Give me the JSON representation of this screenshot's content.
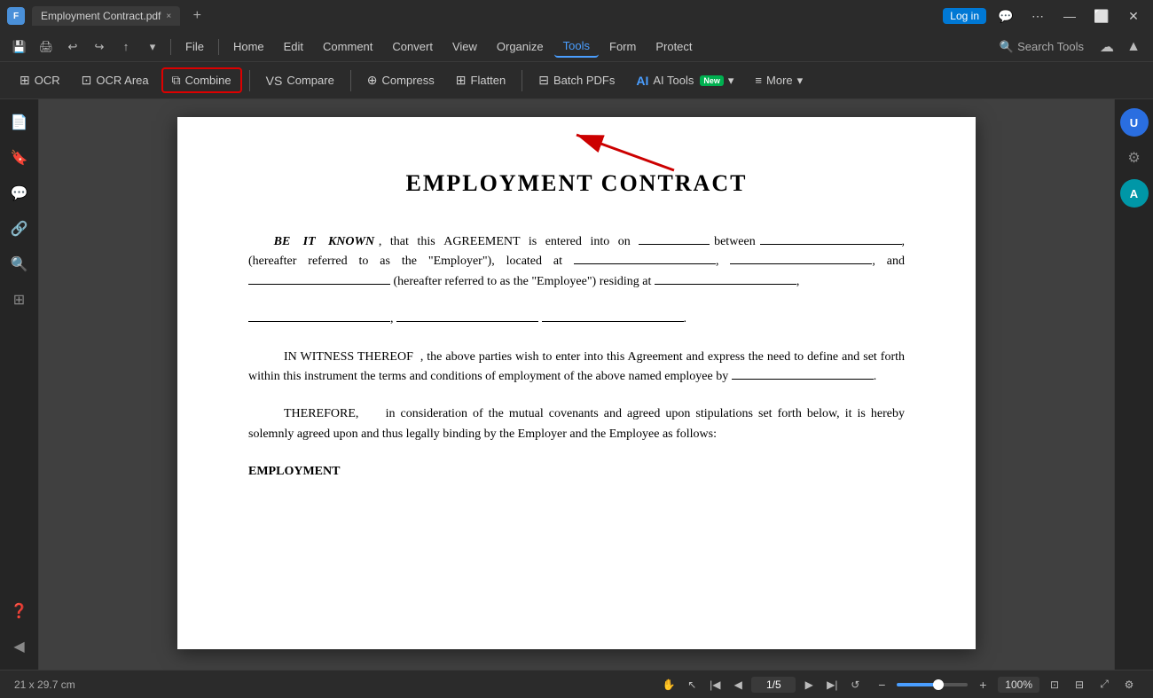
{
  "titleBar": {
    "appLogo": "F",
    "tabName": "Employment Contract.pdf",
    "tabCloseLabel": "×",
    "newTabLabel": "+",
    "loginLabel": "Log in",
    "windowControls": [
      "minimize",
      "maximize",
      "close"
    ]
  },
  "menuBar": {
    "items": [
      {
        "label": "File",
        "active": false
      },
      {
        "label": "Home",
        "active": false
      },
      {
        "label": "Edit",
        "active": false
      },
      {
        "label": "Comment",
        "active": false
      },
      {
        "label": "Convert",
        "active": false
      },
      {
        "label": "View",
        "active": false
      },
      {
        "label": "Organize",
        "active": false
      },
      {
        "label": "Tools",
        "active": true
      },
      {
        "label": "Form",
        "active": false
      },
      {
        "label": "Protect",
        "active": false
      }
    ],
    "searchTools": "Search Tools"
  },
  "toolbar": {
    "items": [
      {
        "id": "ocr",
        "icon": "⊞",
        "label": "OCR",
        "highlighted": false
      },
      {
        "id": "ocr-area",
        "icon": "⊡",
        "label": "OCR Area",
        "highlighted": false
      },
      {
        "id": "combine",
        "icon": "⧉",
        "label": "Combine",
        "highlighted": true
      },
      {
        "id": "compare",
        "icon": "VS",
        "label": "Compare",
        "highlighted": false
      },
      {
        "id": "compress",
        "icon": "⊕",
        "label": "Compress",
        "highlighted": false
      },
      {
        "id": "flatten",
        "icon": "⊞",
        "label": "Flatten",
        "highlighted": false
      },
      {
        "id": "batch-pdfs",
        "icon": "⊟",
        "label": "Batch PDFs",
        "highlighted": false
      },
      {
        "id": "ai-tools",
        "icon": "AI",
        "label": "AI Tools",
        "hasNew": true,
        "highlighted": false
      },
      {
        "id": "more",
        "icon": "≡",
        "label": "More",
        "highlighted": false
      }
    ]
  },
  "pdfViewer": {
    "title": "EMPLOYMENT CONTRACT",
    "paragraphs": {
      "para1": "BE IT KNOWN , that this AGREEMENT is entered into on __________________ between ______________________, (hereafter referred to as the \"Employer\"), located at ______________________, ______________________, and ______________________ (hereafter referred to as the \"Employee\") residing at ______________________,",
      "para1end": "______________________, ______________________ ______________________.",
      "para2": "IN WITNESS THEREOF , the above parties wish to enter into this Agreement and express the need to define and set forth within this instrument the terms and conditions of employment of the above named employee by ______________________.",
      "para3": "THEREFORE,    in consideration of the mutual covenants and agreed upon stipulations set forth below, it is hereby solemnly agreed upon and thus legally binding by the Employer and the Employee as follows:",
      "section": "EMPLOYMENT"
    }
  },
  "statusBar": {
    "dimensions": "21 x 29.7 cm",
    "currentPage": "1",
    "totalPages": "5",
    "pageDisplay": "1/5",
    "zoomLevel": "100%"
  },
  "sidebar": {
    "icons": [
      "📄",
      "🔖",
      "💬",
      "🔗",
      "🔍",
      "⊞"
    ]
  },
  "rightSidebar": {
    "avatarBlueLabel": "U",
    "avatarTealLabel": "A"
  }
}
